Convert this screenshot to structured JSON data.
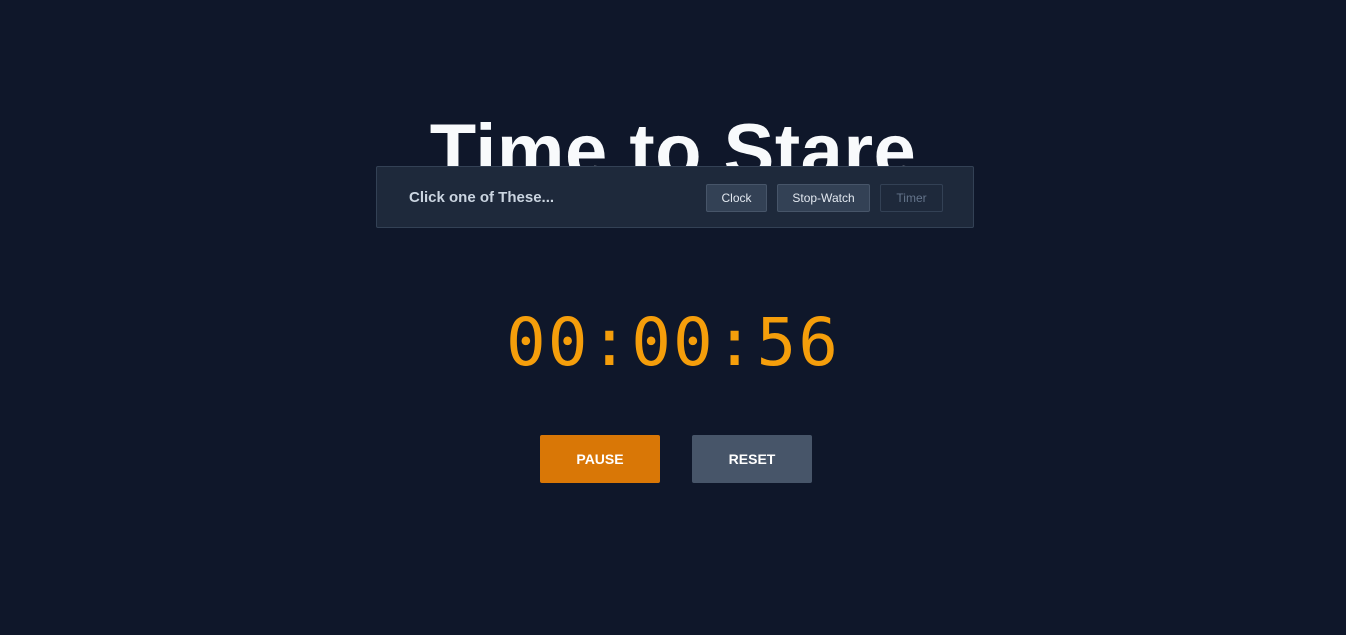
{
  "header": {
    "title": "Time to Stare"
  },
  "mode_selector": {
    "prompt": "Click one of These...",
    "options": [
      {
        "label": "Clock",
        "state": "enabled"
      },
      {
        "label": "Stop-Watch",
        "state": "enabled"
      },
      {
        "label": "Timer",
        "state": "disabled"
      }
    ]
  },
  "display": {
    "time": "00:00:56"
  },
  "controls": {
    "pause_label": "PAUSE",
    "reset_label": "RESET"
  },
  "colors": {
    "background": "#0f172a",
    "time_accent": "#f59e0b",
    "pause_button": "#d97706",
    "reset_button": "#475569"
  }
}
